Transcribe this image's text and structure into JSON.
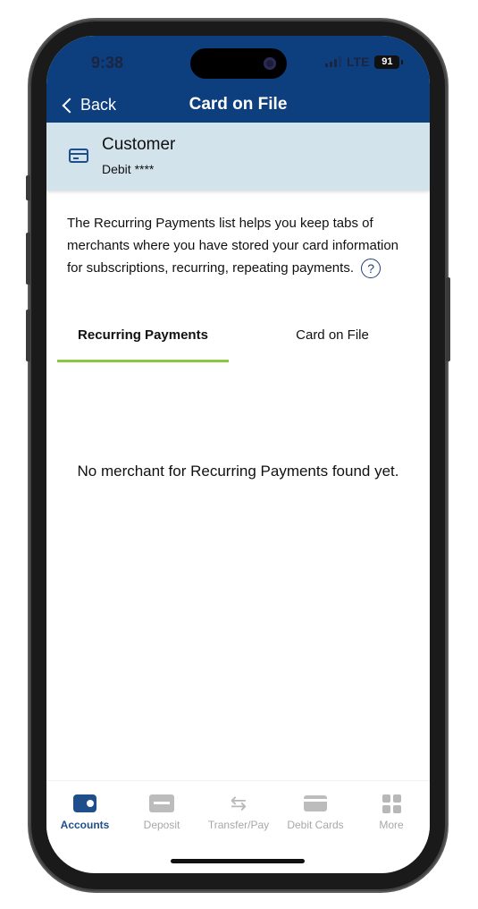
{
  "status_bar": {
    "time": "9:38",
    "network": "LTE",
    "battery": "91"
  },
  "header": {
    "back_label": "Back",
    "title": "Card on File"
  },
  "account": {
    "name": "Customer",
    "subtitle": "Debit ****"
  },
  "description": "The Recurring Payments list helps you keep tabs of merchants where you have stored your card information for subscriptions, recurring, repeating payments.",
  "tabs": [
    {
      "label": "Recurring Payments",
      "active": true
    },
    {
      "label": "Card on File",
      "active": false
    }
  ],
  "empty_message": "No merchant for Recurring Payments found yet.",
  "bottom_nav": [
    {
      "label": "Accounts",
      "icon": "wallet-icon",
      "active": true
    },
    {
      "label": "Deposit",
      "icon": "deposit-icon",
      "active": false
    },
    {
      "label": "Transfer/Pay",
      "icon": "transfer-icon",
      "active": false
    },
    {
      "label": "Debit Cards",
      "icon": "card-icon",
      "active": false
    },
    {
      "label": "More",
      "icon": "grid-icon",
      "active": false
    }
  ],
  "colors": {
    "header": "#0d3f7f",
    "account_strip": "#d3e3ec",
    "tab_accent": "#8dc63f",
    "active_nav": "#1f4f8a"
  }
}
